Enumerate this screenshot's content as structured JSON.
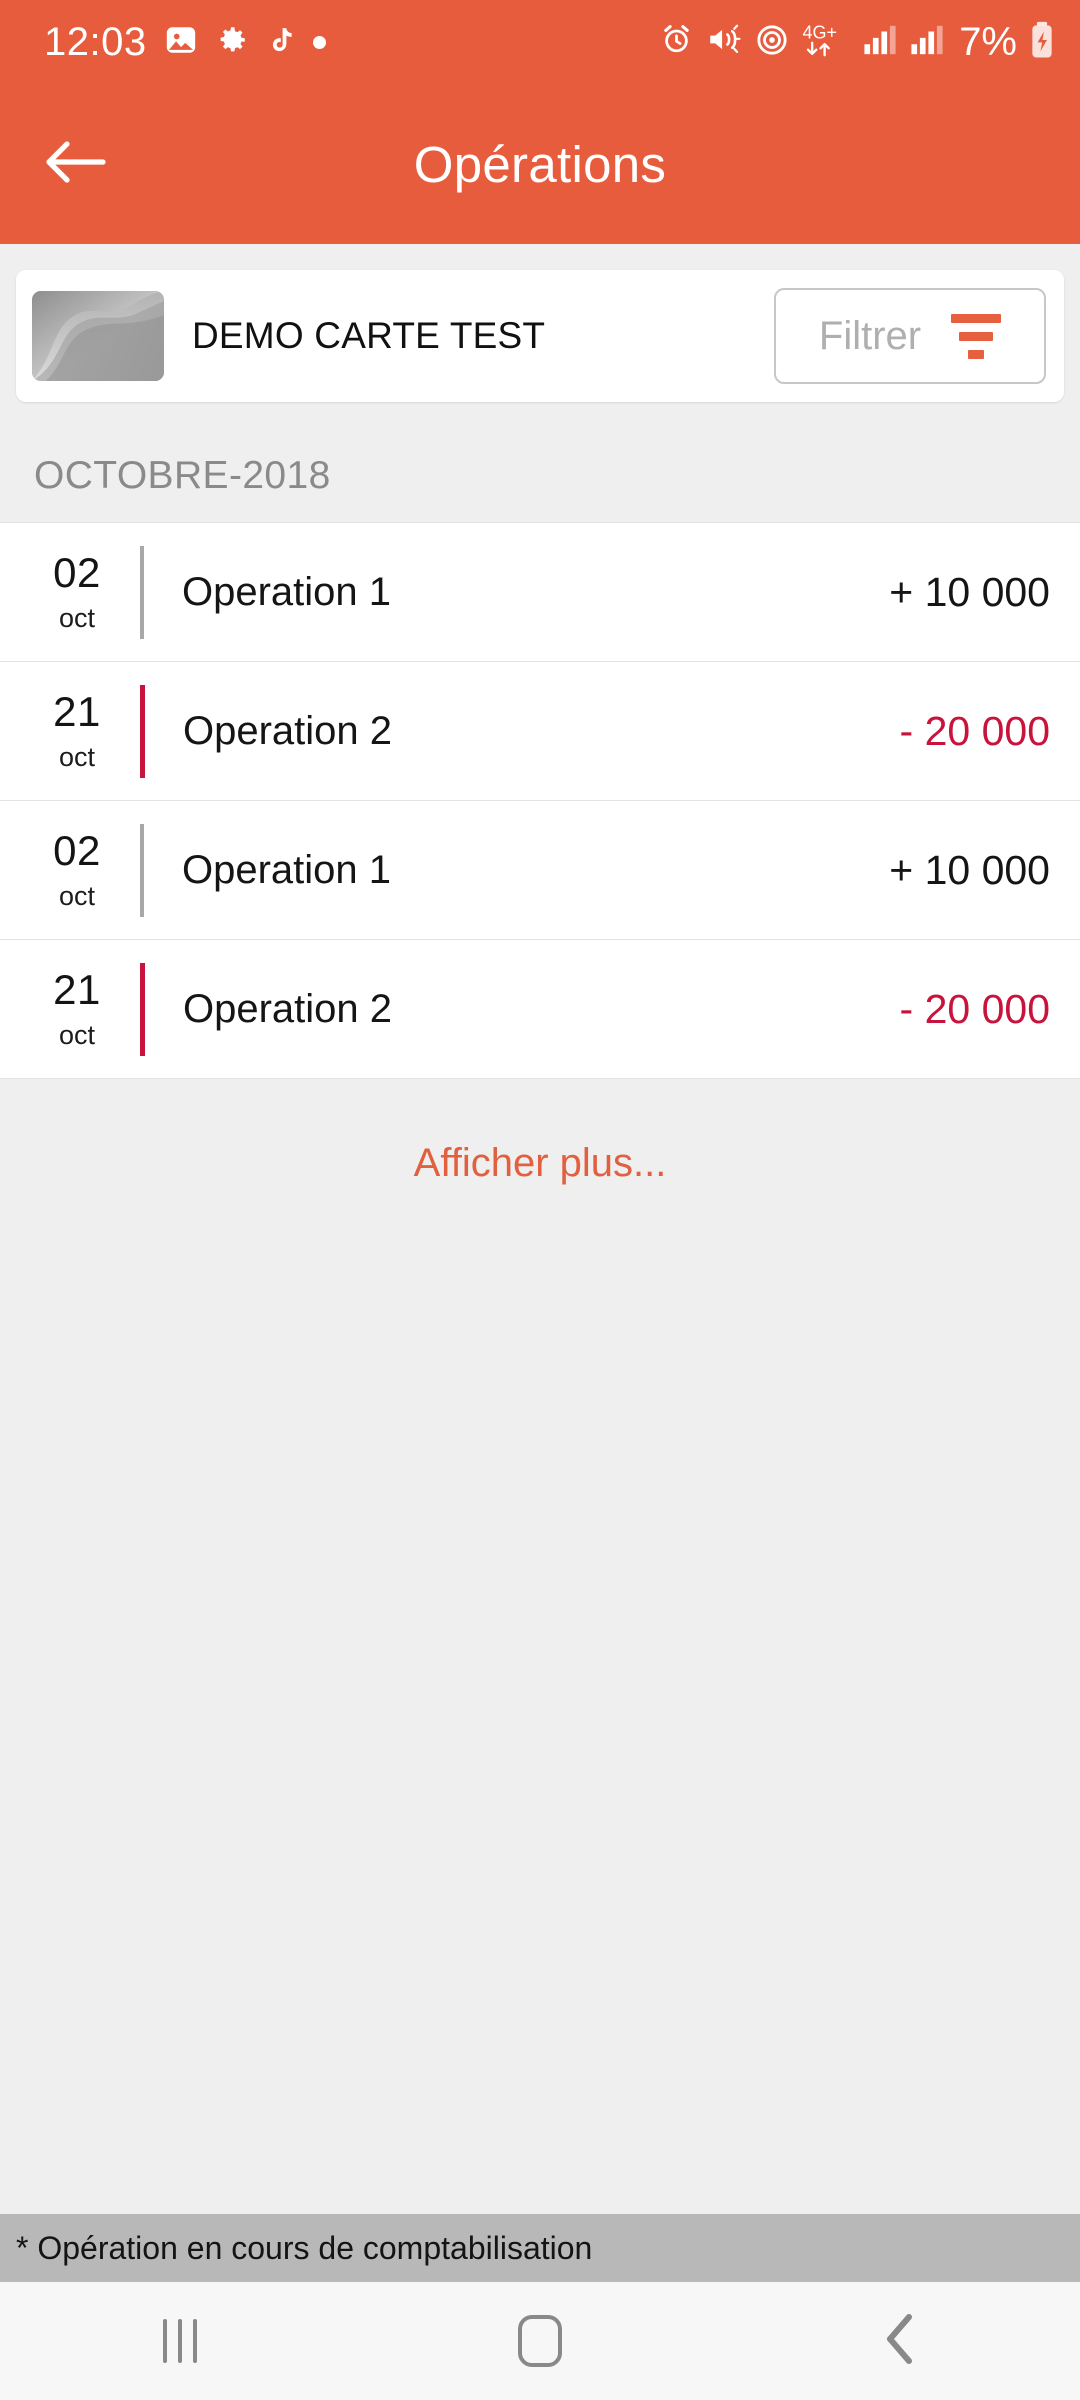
{
  "status_bar": {
    "time": "12:03",
    "battery_percent": "7%",
    "network": "4G+",
    "left_icons": [
      "gallery-icon",
      "gear-icon",
      "tiktok-icon",
      "dot-icon"
    ],
    "right_icons": [
      "alarm-icon",
      "mute-icon",
      "hotspot-icon",
      "network-4gplus-icon",
      "signal-icon",
      "signal-icon",
      "battery-charging-icon"
    ]
  },
  "app_bar": {
    "back_icon": "arrow-left-icon",
    "title": "Opérations"
  },
  "card_panel": {
    "card_name": "DEMO CARTE TEST",
    "thumbnail": "bank-card-thumbnail",
    "filter_button": {
      "label": "Filtrer",
      "icon": "filter-icon"
    }
  },
  "month_header": "OCTOBRE-2018",
  "transactions": [
    {
      "day": "02",
      "month": "oct",
      "title": "Operation 1",
      "amount": "+ 10 000",
      "negative": false
    },
    {
      "day": "21",
      "month": "oct",
      "title": "Operation 2",
      "amount": "- 20 000",
      "negative": true
    },
    {
      "day": "02",
      "month": "oct",
      "title": "Operation 1",
      "amount": "+ 10 000",
      "negative": false
    },
    {
      "day": "21",
      "month": "oct",
      "title": "Operation 2",
      "amount": "- 20 000",
      "negative": true
    }
  ],
  "show_more": "Afficher plus...",
  "footnote": "* Opération en cours de comptabilisation",
  "nav_bar": {
    "recents_label": "recents-icon",
    "home_label": "home-icon",
    "back_label": "back-icon"
  },
  "colors": {
    "brand_orange": "#E85C3E",
    "negative_red": "#C8143C",
    "page_background": "#EFEFEF",
    "footnote_background": "#B8B8B8"
  }
}
